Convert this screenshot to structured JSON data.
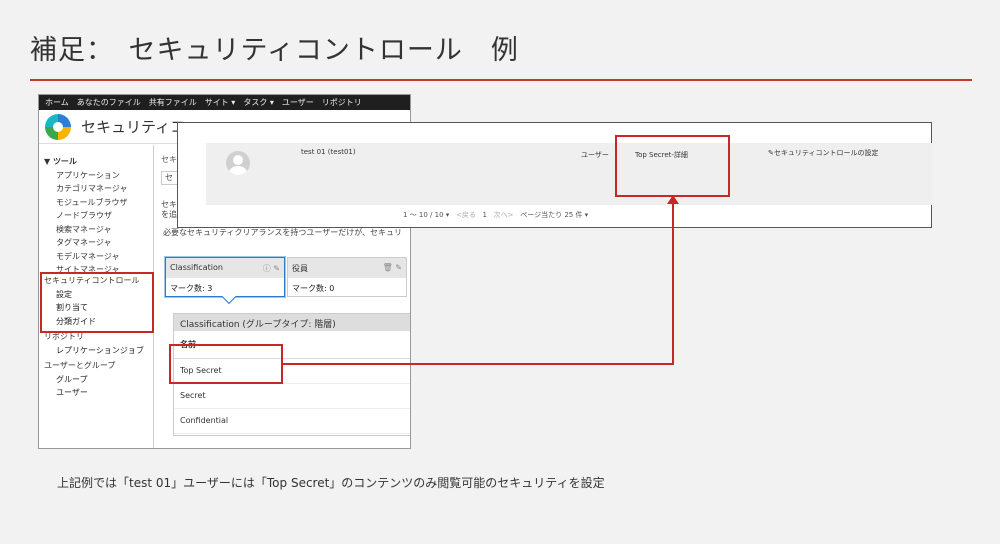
{
  "slide": {
    "title": "補足：　セキュリティコントロール　例",
    "caption": "上記例では「test 01」ユーザーには「Top Secret」のコンテンツのみ閲覧可能のセキュリティを設定"
  },
  "topnav": {
    "items": [
      "ホーム",
      "あなたのファイル",
      "共有ファイル",
      "サイト ▾",
      "タスク ▾",
      "ユーザー",
      "リポジトリ"
    ]
  },
  "app": {
    "title": "セキュリティコ"
  },
  "sidebar": {
    "tools_head": "▼ ツール",
    "tools": [
      "アプリケーション",
      "カテゴリマネージャ",
      "モジュールブラウザ",
      "ノードブラウザ",
      "検索マネージャ",
      "タグマネージャ",
      "モデルマネージャ",
      "サイトマネージャ"
    ],
    "security_group": "セキュリティコントロール",
    "security_items": [
      "設定",
      "割り当て",
      "分類ガイド"
    ],
    "repo_group": "リポジトリ",
    "repo_items": [
      "レプリケーションジョブ"
    ],
    "users_group": "ユーザーとグループ",
    "users_items": [
      "グループ",
      "ユーザー"
    ]
  },
  "content": {
    "heading": "セキ",
    "tab": "セ",
    "desc1": "セキ",
    "desc2": "を追",
    "desc3": "必要なセキュリティクリアランスを持つユーザーだけが、セキュリ",
    "card_a": {
      "title": "Classification",
      "count": "マーク数: 3"
    },
    "card_b": {
      "title": "役員",
      "count": "マーク数: 0"
    },
    "panel": {
      "title": "Classification (グループタイプ: 階層)",
      "column": "名前",
      "rows": [
        "Top Secret",
        "Secret",
        "Confidential"
      ]
    }
  },
  "overlay": {
    "user_name": "test 01 (test01)",
    "role": "ユーザー",
    "clearance": "Top Secret-詳細",
    "settings": "セキュリティコントロールの設定",
    "pager": {
      "range": "1 〜 10 / 10 ▾",
      "prev": "<戻る",
      "page": "1",
      "next": "次へ>",
      "per_page": "ページ当たり 25 件 ▾"
    }
  },
  "colors": {
    "accent_red": "#c62828",
    "title_rule": "#c0392b",
    "card_border": "#2a7ad0"
  }
}
